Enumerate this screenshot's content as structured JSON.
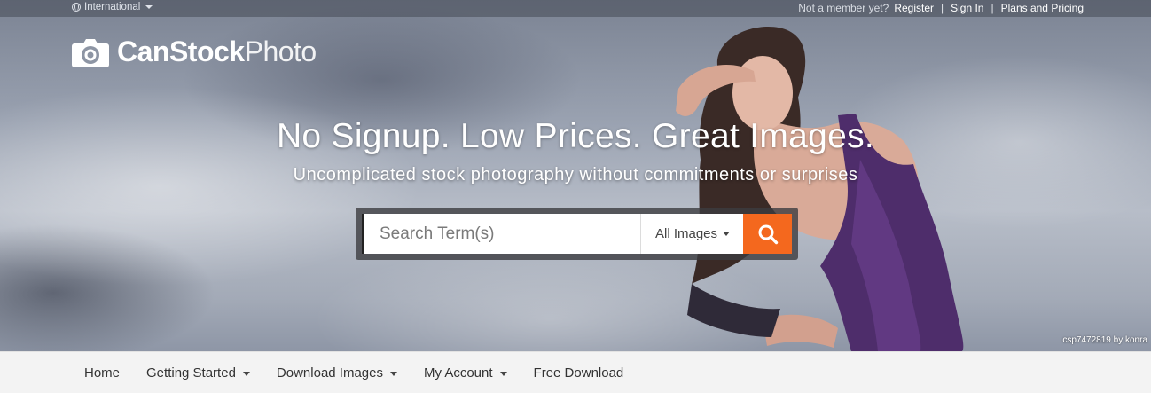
{
  "topbar": {
    "region_label": "International",
    "member_prompt": "Not a member yet?",
    "register_label": "Register",
    "signin_label": "Sign In",
    "plans_label": "Plans and Pricing",
    "separator": "|"
  },
  "logo": {
    "bold": "CanStock",
    "thin": "Photo"
  },
  "hero": {
    "headline": "No Signup. Low Prices. Great Images.",
    "subline": "Uncomplicated stock photography without commitments or surprises",
    "image_credit": "csp7472819 by konra"
  },
  "search": {
    "placeholder": "Search Term(s)",
    "value": "",
    "type_selected": "All Images",
    "accent_color": "#f4681e"
  },
  "nav": {
    "items": [
      {
        "label": "Home",
        "has_dropdown": false
      },
      {
        "label": "Getting Started",
        "has_dropdown": true
      },
      {
        "label": "Download Images",
        "has_dropdown": true
      },
      {
        "label": "My Account",
        "has_dropdown": true
      },
      {
        "label": "Free Download",
        "has_dropdown": false
      }
    ]
  },
  "icons": {
    "region": "globe-icon",
    "search": "search-icon",
    "dropdown": "caret-down-icon",
    "logo": "camera-icon"
  }
}
